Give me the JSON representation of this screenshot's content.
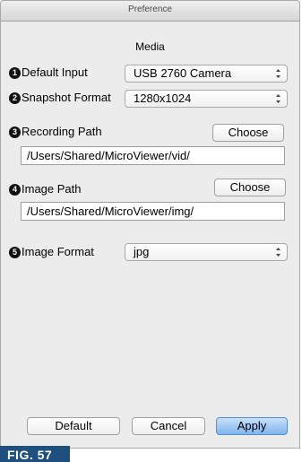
{
  "window": {
    "title": "Preference"
  },
  "section": {
    "title": "Media"
  },
  "rows": {
    "default_input": {
      "num": "1",
      "label": "Default Input",
      "value": "USB 2760 Camera"
    },
    "snapshot_format": {
      "num": "2",
      "label": "Snapshot Format",
      "value": "1280x1024"
    },
    "recording_path": {
      "num": "3",
      "label": "Recording Path",
      "button": "Choose",
      "path": "/Users/Shared/MicroViewer/vid/"
    },
    "image_path": {
      "num": "4",
      "label": "Image Path",
      "button": "Choose",
      "path": "/Users/Shared/MicroViewer/img/"
    },
    "image_format": {
      "num": "5",
      "label": "Image Format",
      "value": "jpg"
    }
  },
  "footer": {
    "default": "Default",
    "cancel": "Cancel",
    "apply": "Apply"
  },
  "figure_label": "FIG. 57",
  "colors": {
    "accent_button": "#7fb4ee",
    "fig_banner": "#1e4f7d"
  }
}
